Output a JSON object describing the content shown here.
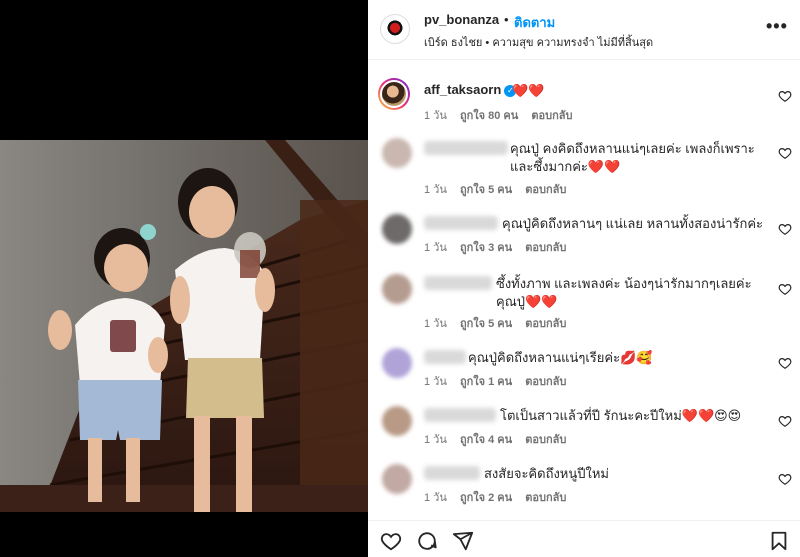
{
  "post": {
    "username": "pv_bonanza",
    "separator": "•",
    "follow_label": "ติดตาม",
    "audio": "เบิร์ด ธงไชย • ความสุข ความทรงจำ ไม่มีที่สิ้นสุด",
    "more_label": "•••"
  },
  "caption": {
    "username": "aff_taksaorn",
    "verified_mark": "✓",
    "text": "❤️❤️",
    "time": "1 วัน",
    "likes": "ถูกใจ 80 คน",
    "reply": "ตอบกลับ"
  },
  "comments": [
    {
      "text": "คุณปู่ คงคิดถึงหลานแน่ๆเลยค่ะ เพลงก็เพราะ และซึ้งมากค่ะ❤️❤️",
      "time": "1 วัน",
      "likes": "ถูกใจ 5 คน",
      "reply": "ตอบกลับ"
    },
    {
      "text": "คุณปู่คิดถึงหลานๆ แน่เลย หลานทั้งสองน่ารักค่ะ",
      "time": "1 วัน",
      "likes": "ถูกใจ 3 คน",
      "reply": "ตอบกลับ"
    },
    {
      "text": "ซึ้งทั้งภาพ และเพลงค่ะ น้องๆน่ารักมากๆเลยค่ะคุณปู่❤️❤️",
      "time": "1 วัน",
      "likes": "ถูกใจ 5 คน",
      "reply": "ตอบกลับ"
    },
    {
      "text": "คุณปู่คิดถึงหลานแน่ๆเรียค่ะ💋🥰",
      "time": "1 วัน",
      "likes": "ถูกใจ 1 คน",
      "reply": "ตอบกลับ"
    },
    {
      "text": "โตเป็นสาวแล้วที่ปี รักนะคะปีใหม่❤️❤️😍😍",
      "time": "1 วัน",
      "likes": "ถูกใจ 4 คน",
      "reply": "ตอบกลับ"
    },
    {
      "text": "สงสัยจะคิดถึงหนูปีใหม่",
      "time": "1 วัน",
      "likes": "ถูกใจ 2 คน",
      "reply": "ตอบกลับ"
    }
  ],
  "icons": {
    "like": "heart-icon",
    "comment": "comment-icon",
    "share": "share-icon",
    "save": "bookmark-icon"
  },
  "colors": {
    "accent": "#0095f6",
    "heart": "#ed1c24"
  }
}
